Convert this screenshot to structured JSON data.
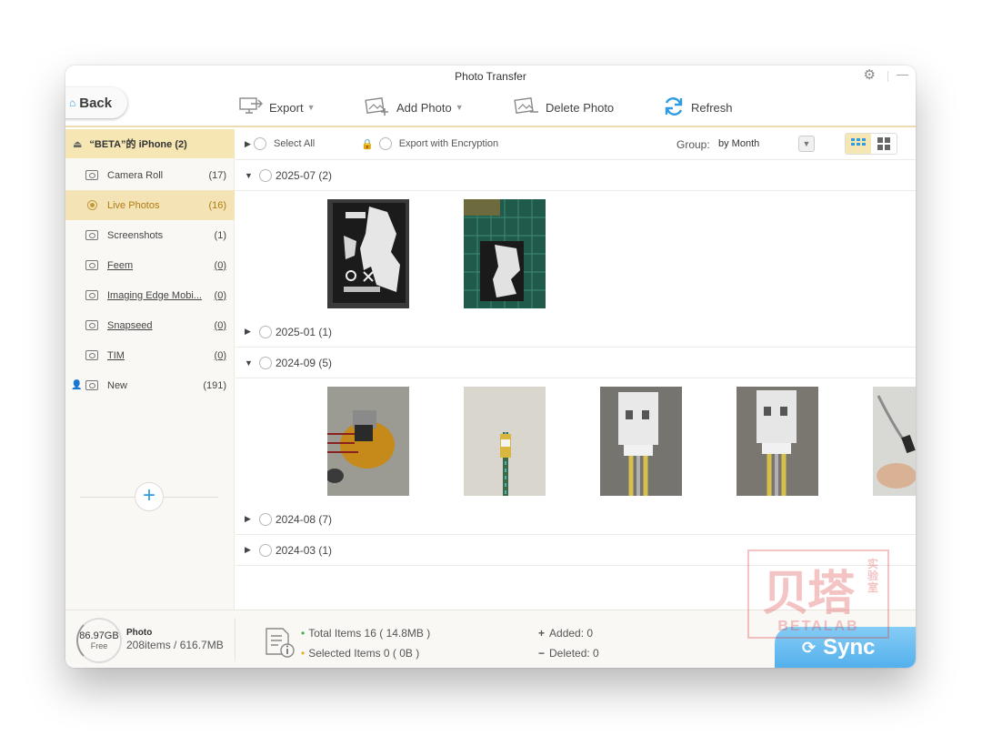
{
  "window": {
    "title": "Photo Transfer"
  },
  "toolbar": {
    "back_label": "Back",
    "export_label": "Export",
    "add_photo_label": "Add Photo",
    "delete_photo_label": "Delete Photo",
    "refresh_label": "Refresh"
  },
  "sidebar": {
    "device_name": "“BETA”的 iPhone (2)",
    "albums": [
      {
        "label": "Camera Roll",
        "count": "(17)",
        "icon": "camera-icon"
      },
      {
        "label": "Live Photos",
        "count": "(16)",
        "icon": "live-photo-icon",
        "active": true
      },
      {
        "label": "Screenshots",
        "count": "(1)",
        "icon": "screenshot-icon"
      },
      {
        "label": "Feem",
        "count": "(0)",
        "icon": "album-icon"
      },
      {
        "label": "Imaging Edge Mobi...",
        "count": "(0)",
        "icon": "album-icon"
      },
      {
        "label": "Snapseed",
        "count": "(0)",
        "icon": "album-icon"
      },
      {
        "label": "TIM",
        "count": "(0)",
        "icon": "album-icon"
      },
      {
        "label": "New",
        "count": "(191)",
        "icon": "album-icon"
      }
    ]
  },
  "options": {
    "select_all_label": "Select All",
    "encrypt_label": "Export with Encryption",
    "group_label": "Group:",
    "group_value": "by Month"
  },
  "groups": [
    {
      "label": "2025-07 (2)",
      "expanded": true
    },
    {
      "label": "2025-01 (1)",
      "expanded": false
    },
    {
      "label": "2024-09 (5)",
      "expanded": true
    },
    {
      "label": "2024-08 (7)",
      "expanded": false
    },
    {
      "label": "2024-03 (1)",
      "expanded": false
    }
  ],
  "footer": {
    "storage_size": "86.97GB",
    "storage_free": "Free",
    "storage_type": "Photo",
    "storage_detail": "208items / 616.7MB",
    "total_items": "Total Items 16 ( 14.8MB )",
    "selected_items": "Selected Items 0 ( 0B )",
    "added": "Added: 0",
    "deleted": "Deleted: 0",
    "sync_label": "Sync"
  },
  "watermark": {
    "cn": "贝塔",
    "side": "实验室",
    "en": "BETALAB"
  },
  "colors": {
    "accent": "#2f9be0",
    "selected_bg": "#f3e3b5",
    "sync_blue": "#5ab5ee"
  }
}
